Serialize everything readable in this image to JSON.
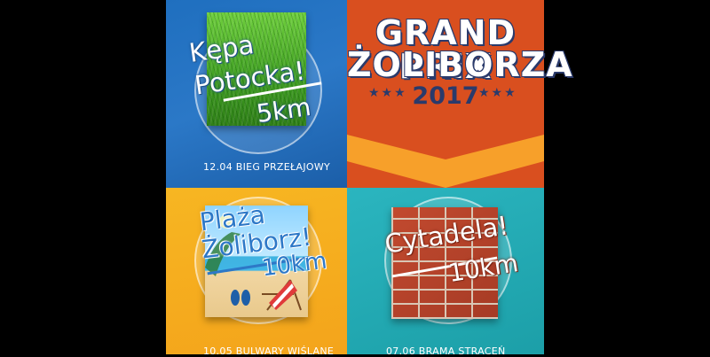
{
  "event": {
    "title_line1": "GRAND PRIX",
    "title_line2": "ŻOLIBORZA",
    "year": "2017",
    "stars_left": "★★★",
    "stars_right": "★★★"
  },
  "races": [
    {
      "name_line1": "Kępa",
      "name_line2": "Potocka!",
      "distance": "5km",
      "caption": "12.04 BIEG PRZEŁAJOWY"
    },
    {
      "name_line1": "Plaża",
      "name_line2": "Żoliborz!",
      "distance": "10km",
      "caption": "10.05 BULWARY WIŚLANE"
    },
    {
      "name_line1": "Cytadela!",
      "distance": "10km",
      "caption": "07.06 BRAMA STRACEŃ"
    }
  ],
  "colors": {
    "blue": "#2b78c7",
    "orange": "#d94f1f",
    "yellow": "#f5ac1f",
    "teal": "#26aab4",
    "navy": "#2a3a6b"
  }
}
